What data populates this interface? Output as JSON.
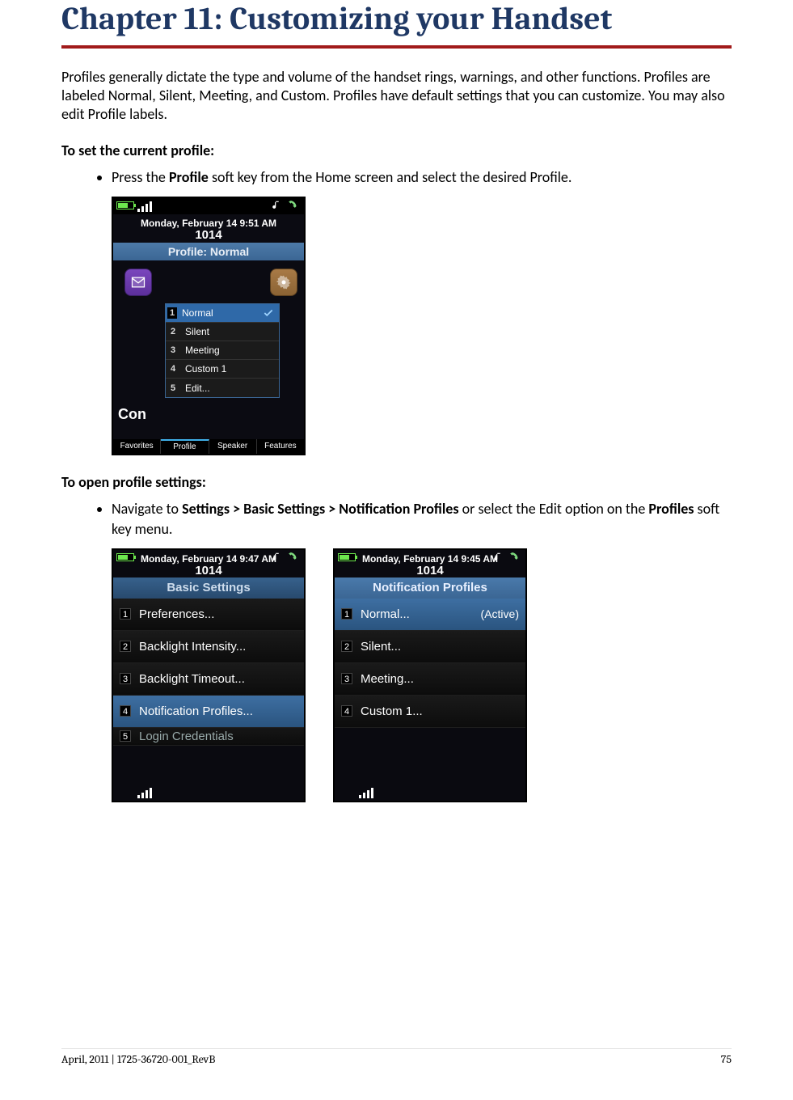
{
  "title": "Chapter 11: Customizing your Handset",
  "intro": "Profiles generally dictate the type and volume of the handset rings, warnings, and other functions. Profiles are labeled Normal, Silent, Meeting, and Custom. Profiles have default settings that you can customize. You may also edit Profile labels.",
  "head1": "To set the current profile:",
  "step1_pre": "Press the ",
  "step1_b": "Profile",
  "step1_post": " soft key from the Home screen and select the desired Profile.",
  "phone1": {
    "date": "Monday, February 14 9:51 AM",
    "ext": "1014",
    "bluebar": "Profile: Normal",
    "popup": {
      "items": [
        {
          "idx": "1",
          "label": "Normal",
          "selected": true
        },
        {
          "idx": "2",
          "label": "Silent"
        },
        {
          "idx": "3",
          "label": "Meeting"
        },
        {
          "idx": "4",
          "label": "Custom 1"
        },
        {
          "idx": "5",
          "label": "Edit..."
        }
      ]
    },
    "left_text": "Con",
    "softkeys": [
      "Favorites",
      "Profile",
      "Speaker",
      "Features"
    ]
  },
  "head2": "To open profile settings:",
  "step2_pre": "Navigate to ",
  "step2_b1": "Settings > Basic Settings > Notification Profiles",
  "step2_mid": " or select the Edit option on the ",
  "step2_b2": "Profiles",
  "step2_post": " soft key menu.",
  "phoneA": {
    "date": "Monday, February 14 9:47 AM",
    "ext": "1014",
    "title": "Basic Settings",
    "rows": [
      {
        "idx": "1",
        "label": "Preferences..."
      },
      {
        "idx": "2",
        "label": "Backlight Intensity..."
      },
      {
        "idx": "3",
        "label": "Backlight Timeout..."
      },
      {
        "idx": "4",
        "label": "Notification Profiles...",
        "selected": true
      },
      {
        "idx": "5",
        "label": "Login Credentials",
        "cut": true
      }
    ]
  },
  "phoneB": {
    "date": "Monday, February 14 9:45 AM",
    "ext": "1014",
    "title": "Notification Profiles",
    "rows": [
      {
        "idx": "1",
        "label": "Normal...",
        "suffix": "(Active)",
        "selected": true
      },
      {
        "idx": "2",
        "label": "Silent..."
      },
      {
        "idx": "3",
        "label": "Meeting..."
      },
      {
        "idx": "4",
        "label": "Custom 1..."
      }
    ]
  },
  "footer_left": "April, 2011  |  1725-36720-001_RevB",
  "footer_right": "75"
}
